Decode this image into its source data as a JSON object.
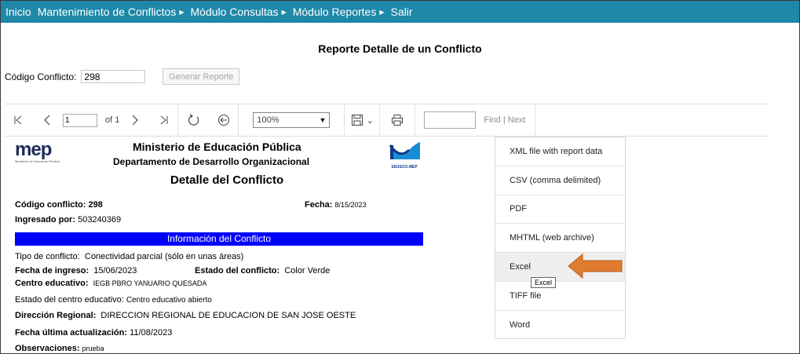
{
  "nav": {
    "items": [
      {
        "label": "Inicio",
        "arrow": false
      },
      {
        "label": "Mantenimiento de Conflictos",
        "arrow": true
      },
      {
        "label": "Módulo Consultas",
        "arrow": true
      },
      {
        "label": "Módulo Reportes",
        "arrow": true
      },
      {
        "label": "Salir",
        "arrow": false
      }
    ]
  },
  "page": {
    "title": "Reporte Detalle de un Conflicto"
  },
  "form": {
    "code_label": "Código Conflicto:",
    "code_value": "298",
    "generate_label": "Generar Reporte"
  },
  "toolbar": {
    "page_value": "1",
    "of_label": "of 1",
    "zoom": "100%",
    "find_label": "Find",
    "next_label": "Next"
  },
  "report": {
    "logo_text": "mep",
    "logo_sub": "Ministerio de Educación Pública",
    "ministerio": "Ministerio de Educación Pública",
    "departamento": "Departamento de Desarrollo Organizacional",
    "detalle": "Detalle del Conflicto",
    "sigisco": "SIGISCO-MEP",
    "codigo_label": "Código conflicto:",
    "codigo_value": "298",
    "fecha_label": "Fecha:",
    "fecha_value": "8/15/2023",
    "ingresado_label": "Ingresado por:",
    "ingresado_value": "503240369",
    "section_title": "Información del Conflicto",
    "tipo_label": "Tipo de conflicto:",
    "tipo_value": "Conectividad parcial (sólo en unas áreas)",
    "fecha_ingreso_label": "Fecha de ingreso:",
    "fecha_ingreso_value": "15/06/2023",
    "estado_label": "Estado del conflicto:",
    "estado_value": "Color Verde",
    "centro_label": "Centro educativo:",
    "centro_value": "IEGB PBRO YANUARIO QUESADA",
    "estado_centro_label": "Estado del centro educativo:",
    "estado_centro_value": "Centro educativo abierto",
    "direccion_label": "Dirección Regional:",
    "direccion_value": "DIRECCION REGIONAL DE EDUCACION DE SAN JOSE OESTE",
    "actualizacion_label": "Fecha última actualización:",
    "actualizacion_value": "11/08/2023",
    "observaciones_label": "Observaciones:",
    "observaciones_value": "prueba"
  },
  "export_menu": {
    "items": [
      "XML file with report data",
      "CSV (comma delimited)",
      "PDF",
      "MHTML (web archive)",
      "Excel",
      "TIFF file",
      "Word"
    ],
    "hovered": "Excel",
    "tooltip": "Excel"
  },
  "colors": {
    "nav_bg": "#1e88a8",
    "section_bar": "#0000ff",
    "arrow": "#e07b30"
  },
  "icons": [
    "first-page-icon",
    "prev-page-icon",
    "next-page-icon",
    "last-page-icon",
    "refresh-icon",
    "back-icon",
    "save-icon",
    "chevron-down-icon",
    "print-icon"
  ]
}
